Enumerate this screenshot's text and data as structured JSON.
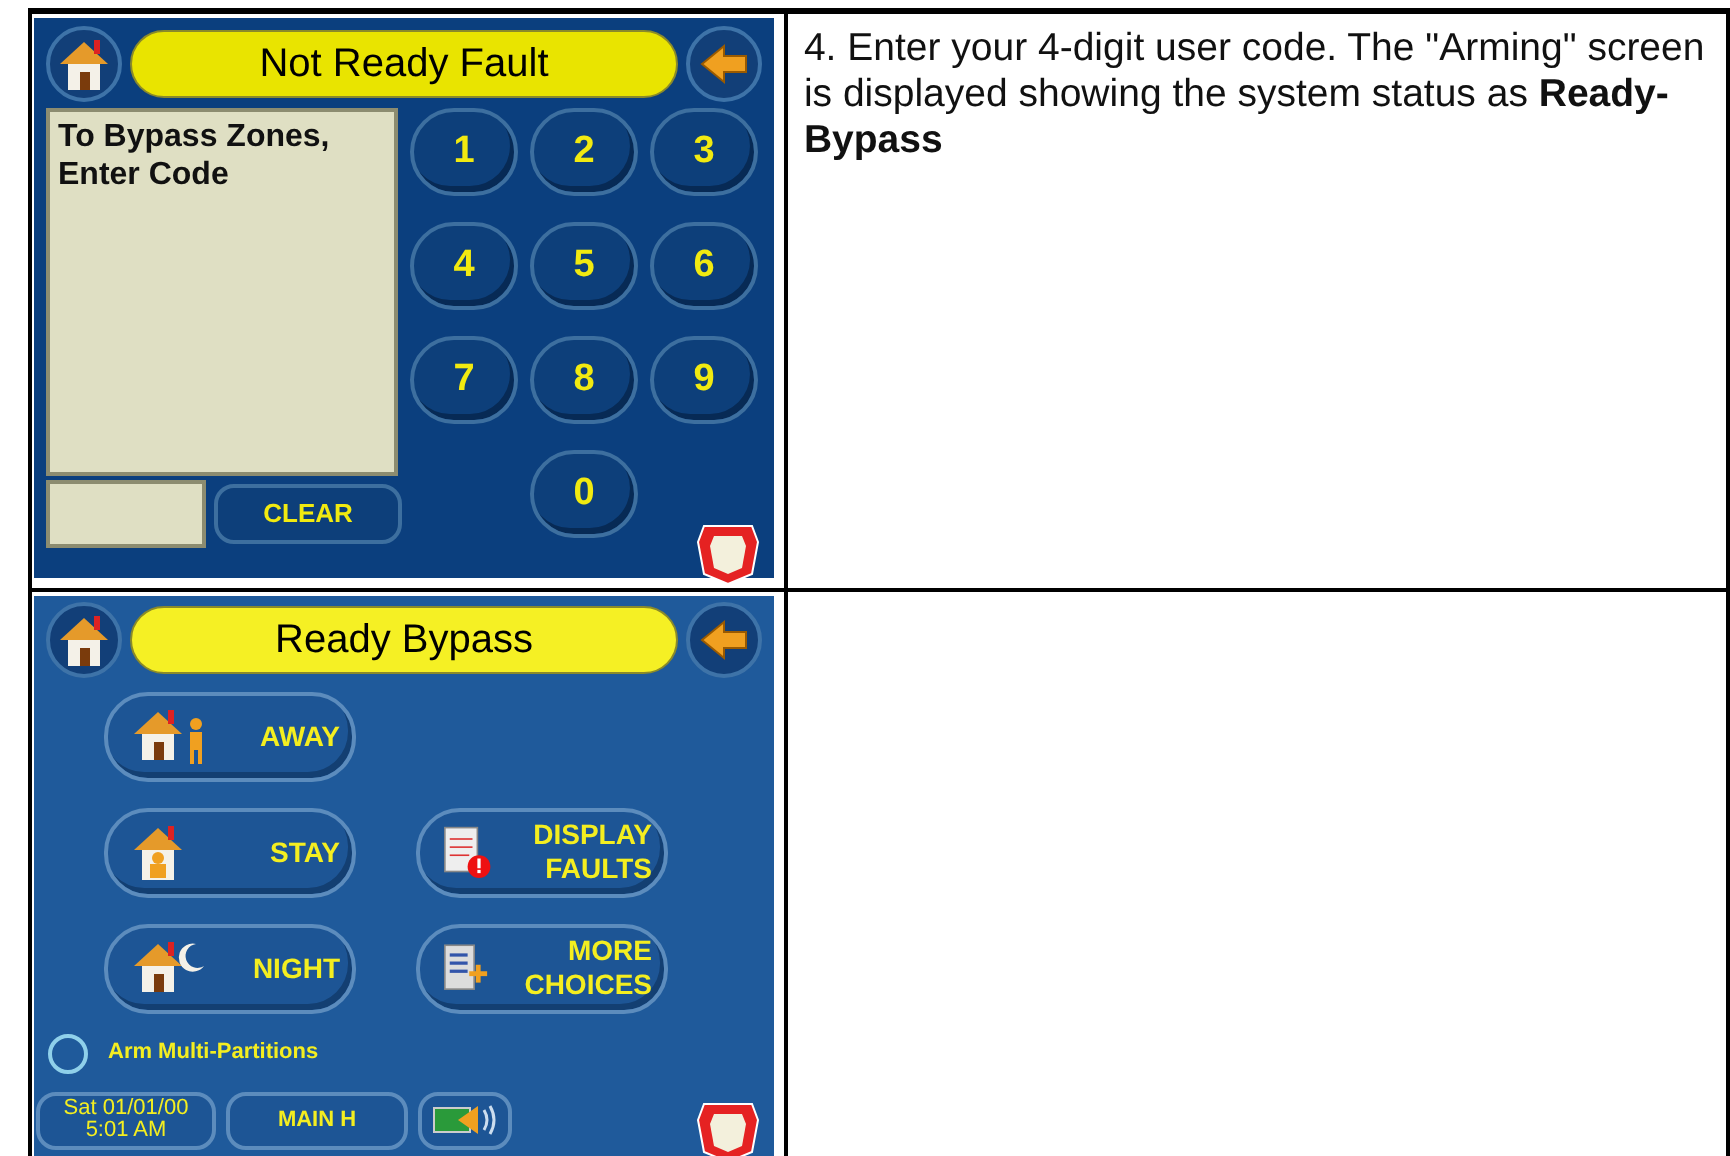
{
  "steps": [
    {
      "instruction": "4.  Enter your 4-digit user code.  The \"Arming\" screen is displayed showing the system status as **Ready-Bypass**",
      "screen": {
        "kind": "keypad",
        "title": "Not Ready Fault",
        "message": "To Bypass Zones, Enter Code",
        "keys": [
          "1",
          "2",
          "3",
          "4",
          "5",
          "6",
          "7",
          "8",
          "9",
          "0"
        ],
        "clear_label": "CLEAR"
      }
    },
    {
      "screen": {
        "kind": "arming",
        "title": "Ready Bypass",
        "buttons": [
          {
            "kind": "away",
            "label": "AWAY"
          },
          {
            "kind": "empty"
          },
          {
            "kind": "stay",
            "label": "STAY"
          },
          {
            "kind": "faults",
            "label": "DISPLAY FAULTS"
          },
          {
            "kind": "night",
            "label": "NIGHT"
          },
          {
            "kind": "more",
            "label": "MORE CHOICES"
          }
        ],
        "option": {
          "label": "Arm Multi-Partitions",
          "checked": false
        },
        "footer": {
          "date": "Sat 01/01/00",
          "time": "5:01 AM",
          "partition": "MAIN H"
        }
      }
    }
  ]
}
